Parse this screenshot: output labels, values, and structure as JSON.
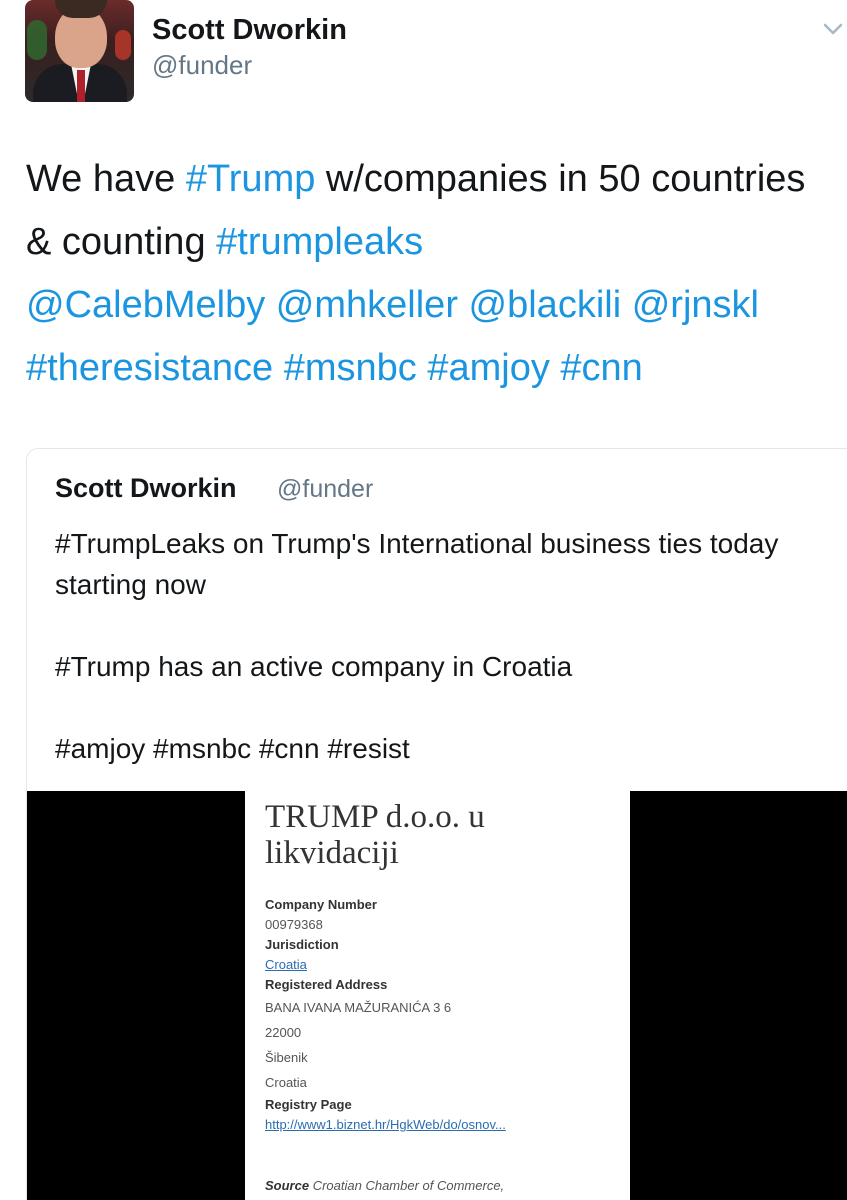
{
  "tweet": {
    "author_name": "Scott Dworkin",
    "author_handle": "@funder",
    "text_parts": {
      "p1": "We have ",
      "t1": "#Trump",
      "p2": " w/companies in 50 countries & counting ",
      "t2": "#trumpleaks",
      "m1": "@CalebMelby",
      "m2": "@mhkeller",
      "m3": "@blackili",
      "m4": "@rjnskl",
      "t3": "#theresistance",
      "t4": "#msnbc",
      "t5": "#amjoy",
      "t6": "#cnn"
    }
  },
  "quoted_tweet": {
    "author_name": "Scott Dworkin",
    "author_handle": "@funder",
    "text": "#TrumpLeaks on Trump's International business ties today starting now\n\n#Trump has an active company in Croatia\n\n#amjoy #msnbc #cnn #resist"
  },
  "registry_image": {
    "title": "TRUMP d.o.o. u likvidaciji",
    "company_number_label": "Company Number",
    "company_number": "00979368",
    "jurisdiction_label": "Jurisdiction",
    "jurisdiction": "Croatia",
    "address_label": "Registered Address",
    "address_line1": "BANA IVANA MAŽURANIĆA 3 6",
    "address_line2": "22000",
    "address_line3": "Šibenik",
    "address_line4": "Croatia",
    "registry_page_label": "Registry Page",
    "registry_page_url": "http://www1.biznet.hr/HgkWeb/do/osnov...",
    "source_label": "Source",
    "source_text": "Croatian Chamber of Commerce,"
  },
  "icons": {
    "menu": "chevron-down-icon",
    "avatar": "profile-photo"
  },
  "colors": {
    "link": "#1b95e0",
    "muted": "#657786",
    "text": "#14171a",
    "border": "#e1e8ed"
  }
}
